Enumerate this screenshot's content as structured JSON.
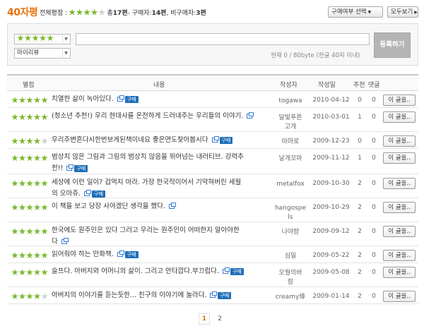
{
  "header": {
    "title": "40자평",
    "overall_label": "전체평점 :",
    "overall_rating": 4,
    "total_text": "총",
    "total_count": "17편",
    "buyer_text": "- 구매자:",
    "buyer_count": "14편",
    "nonbuyer_text": ", 비구매자:",
    "nonbuyer_count": "3편",
    "filter_button": "구매여부 선택",
    "view_all_button": "모두보기"
  },
  "form": {
    "rating_select_value": 5,
    "type_select_value": "마이리뷰",
    "text_value": "",
    "counter": "현재 0 / 80byte (한글 40자 이내)",
    "submit_label": "등록하기"
  },
  "table": {
    "headers": {
      "rating": "별점",
      "content": "내용",
      "author": "작성자",
      "date": "작성일",
      "recommend": "추천",
      "comments": "댓글"
    },
    "buy_badge": "구매",
    "more_label": "이 글을..",
    "rows": [
      {
        "rating": 5,
        "lines": [
          "치열한 삶이 녹아있다."
        ],
        "buy": true,
        "author": [
          "togawa"
        ],
        "date": "2010-04-12",
        "rec": "0",
        "com": "0"
      },
      {
        "rating": 5,
        "lines": [
          "(청소년 추천!) 우리 현대사를 온전하게 드러내주는 우리들의 이야기."
        ],
        "buy": false,
        "author": [
          "달빛푸른",
          "고개"
        ],
        "date": "2010-03-01",
        "rec": "1",
        "com": "0"
      },
      {
        "rating": 4,
        "lines": [
          "우리주변흔다시한번보게된책이네요 좋은면도찾아봅시다"
        ],
        "buy": true,
        "author": [
          "아마로"
        ],
        "date": "2009-12-23",
        "rec": "0",
        "com": "0"
      },
      {
        "rating": 5,
        "lines": [
          "범상치 않은 그림과 그림의 범상치 않음을 뛰어넘는 내러티브. 강력추",
          "천!!"
        ],
        "buy": true,
        "author": [
          "날개꼬마"
        ],
        "date": "2009-11-12",
        "rec": "1",
        "com": "0"
      },
      {
        "rating": 5,
        "lines": [
          "세상에 이런 일이? 겁먹지 마라. 가장 한국적이어서 기막혀버린 세월",
          "의 오마쥬."
        ],
        "buy": true,
        "author": [
          "metalfox"
        ],
        "date": "2009-10-30",
        "rec": "2",
        "com": "0"
      },
      {
        "rating": 5,
        "lines": [
          "이 책을 보고 당장 사야겠단 생각을 했다."
        ],
        "buy": false,
        "author": [
          "hangospe",
          "ls"
        ],
        "date": "2009-10-29",
        "rec": "2",
        "com": "0"
      },
      {
        "rating": 5,
        "lines": [
          "한국에도 원주민은 있다 그러고 우리는 원주민이 어떠한지 알아야한",
          "다"
        ],
        "buy": false,
        "author": [
          "나야랑"
        ],
        "date": "2009-09-12",
        "rec": "2",
        "com": "0"
      },
      {
        "rating": 5,
        "lines": [
          "읽어줘야 하는 만화책."
        ],
        "buy": true,
        "author": [
          "심일"
        ],
        "date": "2009-05-22",
        "rec": "2",
        "com": "0"
      },
      {
        "rating": 5,
        "lines": [
          "슬프다. 아버지와 어머니의 삶이. 그리고 안타깝다.부끄럽다."
        ],
        "buy": true,
        "author": [
          "오월의바",
          "람"
        ],
        "date": "2009-05-08",
        "rec": "2",
        "com": "0"
      },
      {
        "rating": 4,
        "lines": [
          "아버지의 이야기를 듣는듯한... 친구의 이야기에 놀라다."
        ],
        "buy": true,
        "author": [
          "creamy俳"
        ],
        "date": "2009-01-14",
        "rec": "2",
        "com": "0"
      }
    ]
  },
  "pagination": {
    "pages": [
      "1",
      "2"
    ],
    "current": "1"
  }
}
